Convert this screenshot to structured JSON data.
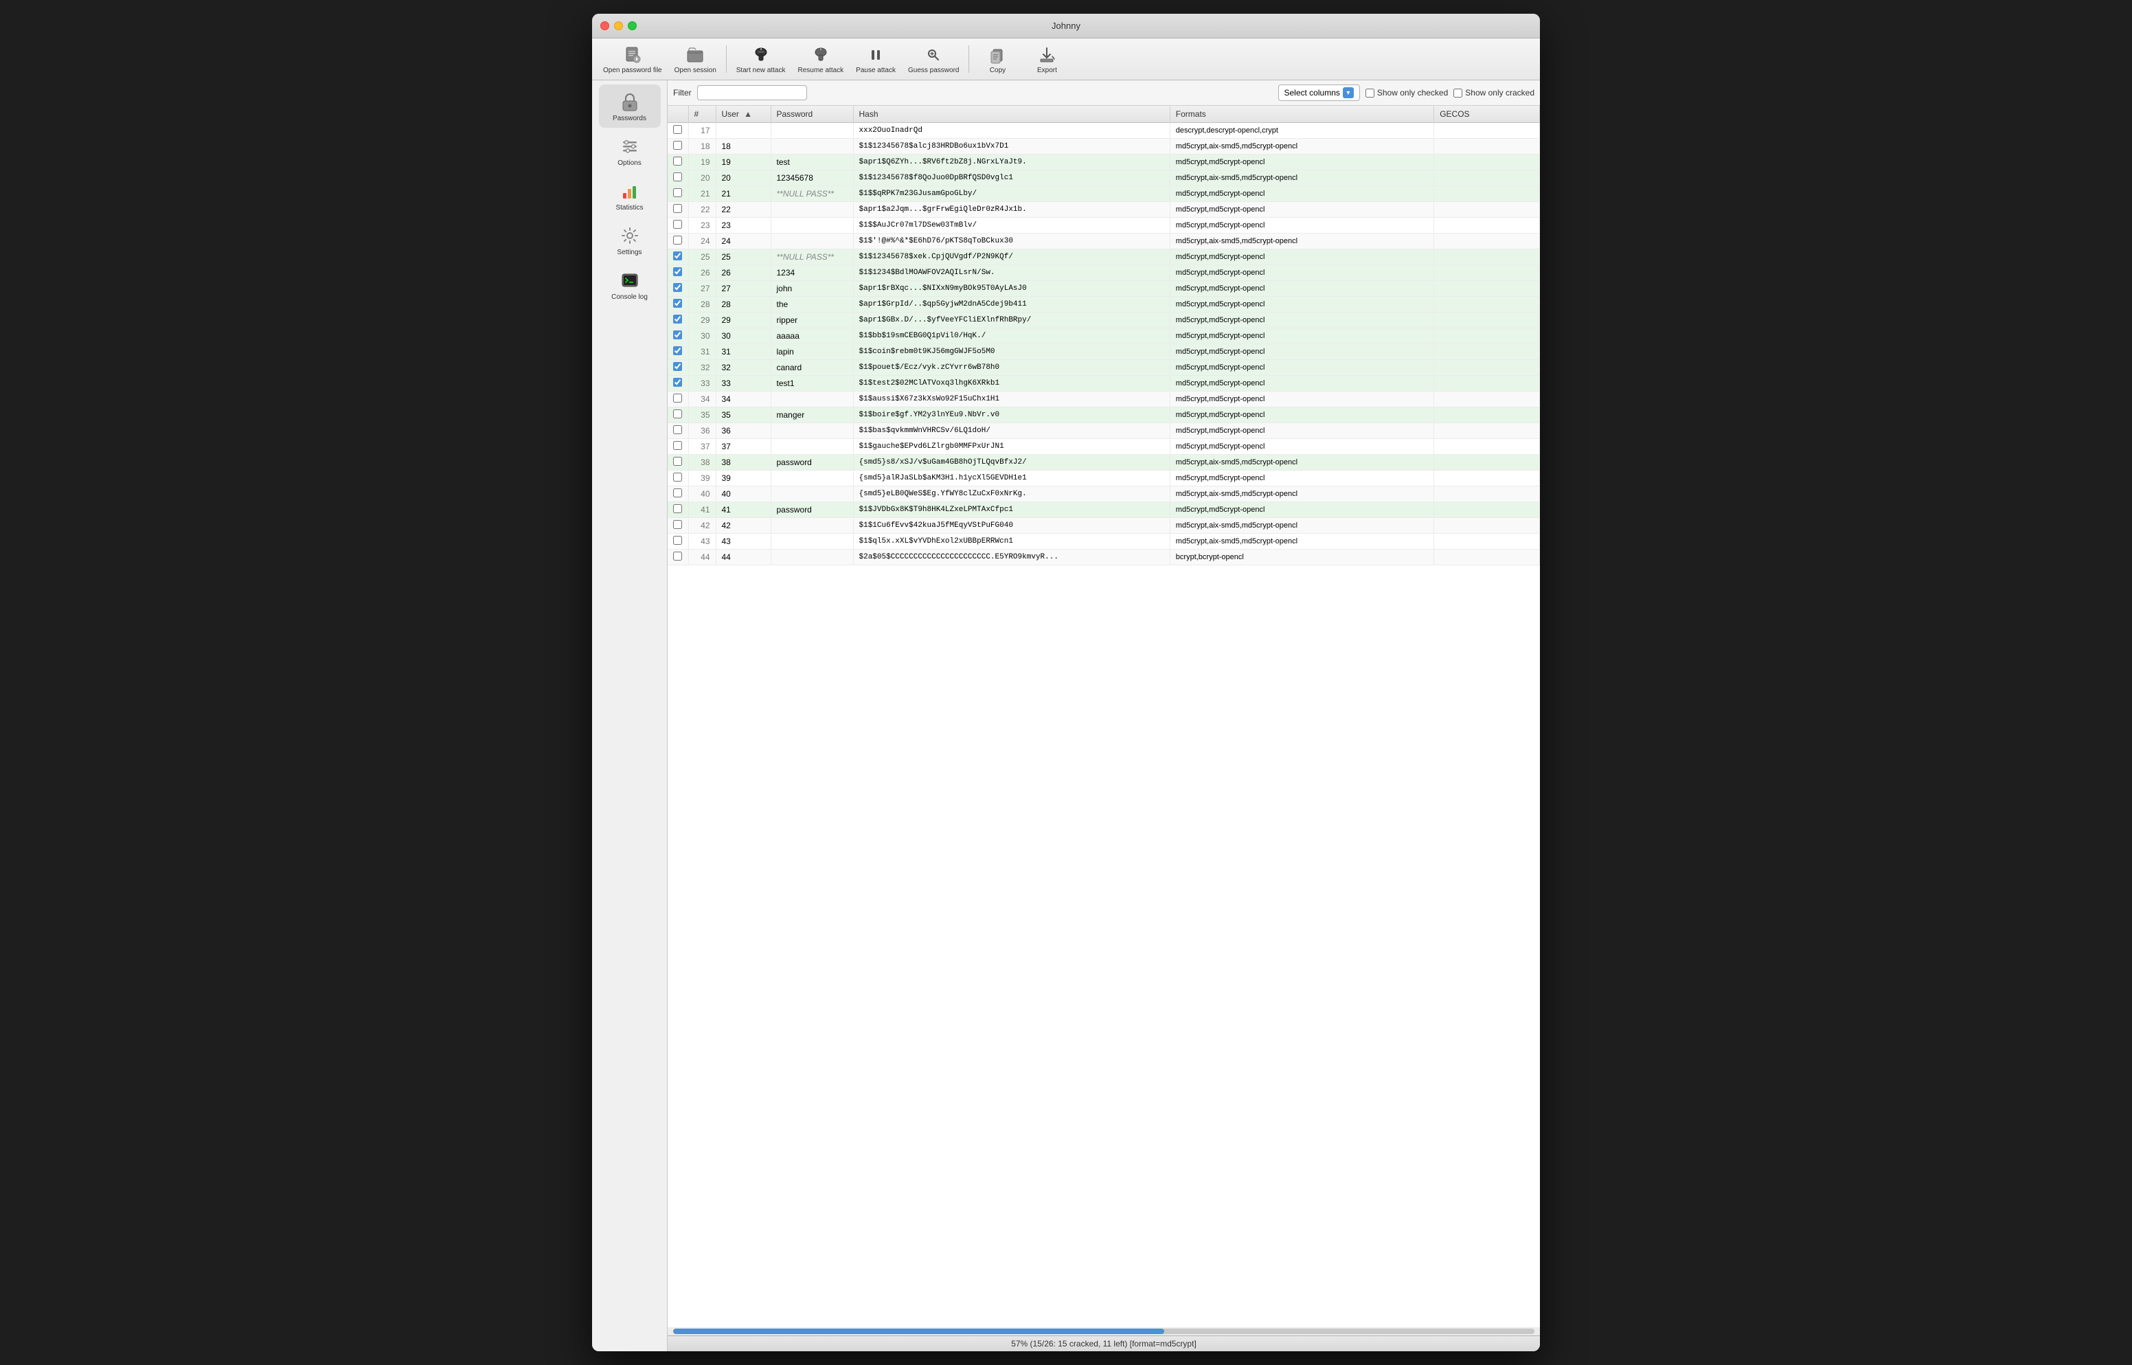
{
  "window": {
    "title": "Johnny"
  },
  "toolbar": {
    "buttons": [
      {
        "id": "open-password",
        "label": "Open password file",
        "icon": "📄"
      },
      {
        "id": "open-session",
        "label": "Open session",
        "icon": "📁"
      },
      {
        "id": "start-attack",
        "label": "Start new attack",
        "icon": "🎩"
      },
      {
        "id": "resume-attack",
        "label": "Resume attack",
        "icon": "▶"
      },
      {
        "id": "pause-attack",
        "label": "Pause attack",
        "icon": "⏸"
      },
      {
        "id": "guess-password",
        "label": "Guess password",
        "icon": "🔑"
      },
      {
        "id": "copy",
        "label": "Copy",
        "icon": "💾"
      },
      {
        "id": "export",
        "label": "Export",
        "icon": "📤"
      }
    ]
  },
  "sidebar": {
    "items": [
      {
        "id": "passwords",
        "label": "Passwords",
        "icon": "🔒",
        "active": true
      },
      {
        "id": "options",
        "label": "Options",
        "icon": "⚙️"
      },
      {
        "id": "statistics",
        "label": "Statistics",
        "icon": "📊"
      },
      {
        "id": "settings",
        "label": "Settings",
        "icon": "🔧"
      },
      {
        "id": "console-log",
        "label": "Console log",
        "icon": "💻"
      }
    ]
  },
  "filter": {
    "label": "Filter",
    "placeholder": "",
    "select_columns": "Select columns",
    "show_only_checked": "Show only checked",
    "show_only_cracked": "Show only cracked"
  },
  "table": {
    "columns": [
      "",
      "#",
      "User",
      "Password",
      "Hash",
      "Formats",
      "GECOS"
    ],
    "rows": [
      {
        "num": 17,
        "check": false,
        "user": "",
        "password": "",
        "hash": "xxx2OuoInadrQd",
        "formats": "descrypt,descrypt-opencl,crypt",
        "gecos": "",
        "cracked": false
      },
      {
        "num": 18,
        "check": false,
        "user": "18",
        "password": "",
        "hash": "$1$12345678$alcj83HRDBo6ux1bVx7D1",
        "formats": "md5crypt,aix-smd5,md5crypt-opencl",
        "gecos": "",
        "cracked": false
      },
      {
        "num": 19,
        "check": false,
        "user": "19",
        "password": "test",
        "hash": "$apr1$Q6ZYh...$RV6ft2bZ8j.NGrxLYaJt9.",
        "formats": "md5crypt,md5crypt-opencl",
        "gecos": "",
        "cracked": true
      },
      {
        "num": 20,
        "check": false,
        "user": "20",
        "password": "12345678",
        "hash": "$1$12345678$f8QoJuo0DpBRfQSD0vglc1",
        "formats": "md5crypt,aix-smd5,md5crypt-opencl",
        "gecos": "",
        "cracked": true
      },
      {
        "num": 21,
        "check": false,
        "user": "21",
        "password": "**NULL PASS**",
        "hash": "$1$$qRPK7m23GJusamGpoGLby/",
        "formats": "md5crypt,md5crypt-opencl",
        "gecos": "",
        "cracked": true
      },
      {
        "num": 22,
        "check": false,
        "user": "22",
        "password": "",
        "hash": "$apr1$a2Jqm...$grFrwEgiQleDr0zR4Jx1b.",
        "formats": "md5crypt,md5crypt-opencl",
        "gecos": "",
        "cracked": false
      },
      {
        "num": 23,
        "check": false,
        "user": "23",
        "password": "",
        "hash": "$1$$AuJCr07ml7DSew03TmBlv/",
        "formats": "md5crypt,md5crypt-opencl",
        "gecos": "",
        "cracked": false
      },
      {
        "num": 24,
        "check": false,
        "user": "24",
        "password": "",
        "hash": "$1$'!@#%^&*$E6hD76/pKTS8qToBCkux30",
        "formats": "md5crypt,aix-smd5,md5crypt-opencl",
        "gecos": "",
        "cracked": false
      },
      {
        "num": 25,
        "check": true,
        "user": "25",
        "password": "**NULL PASS**",
        "hash": "$1$12345678$xek.CpjQUVgdf/P2N9KQf/",
        "formats": "md5crypt,md5crypt-opencl",
        "gecos": "",
        "cracked": true
      },
      {
        "num": 26,
        "check": true,
        "user": "26",
        "password": "1234",
        "hash": "$1$1234$BdlMOAWFOV2AQILsrN/Sw.",
        "formats": "md5crypt,md5crypt-opencl",
        "gecos": "",
        "cracked": true
      },
      {
        "num": 27,
        "check": true,
        "user": "27",
        "password": "john",
        "hash": "$apr1$rBXqc...$NIXxN9myBOk95T0AyLAsJ0",
        "formats": "md5crypt,md5crypt-opencl",
        "gecos": "",
        "cracked": true
      },
      {
        "num": 28,
        "check": true,
        "user": "28",
        "password": "the",
        "hash": "$apr1$GrpId/..$qp5GyjwM2dnA5Cdej9b411",
        "formats": "md5crypt,md5crypt-opencl",
        "gecos": "",
        "cracked": true
      },
      {
        "num": 29,
        "check": true,
        "user": "29",
        "password": "ripper",
        "hash": "$apr1$GBx.D/...$yfVeeYFCliEXlnfRhBRpy/",
        "formats": "md5crypt,md5crypt-opencl",
        "gecos": "",
        "cracked": true
      },
      {
        "num": 30,
        "check": true,
        "user": "30",
        "password": "aaaaa",
        "hash": "$1$bb$19smCEBG0Q1pVil0/HqK./",
        "formats": "md5crypt,md5crypt-opencl",
        "gecos": "",
        "cracked": true
      },
      {
        "num": 31,
        "check": true,
        "user": "31",
        "password": "lapin",
        "hash": "$1$coin$rebm0t9KJ56mgGWJF5o5M0",
        "formats": "md5crypt,md5crypt-opencl",
        "gecos": "",
        "cracked": true
      },
      {
        "num": 32,
        "check": true,
        "user": "32",
        "password": "canard",
        "hash": "$1$pouet$/Ecz/vyk.zCYvrr6wB78h0",
        "formats": "md5crypt,md5crypt-opencl",
        "gecos": "",
        "cracked": true
      },
      {
        "num": 33,
        "check": true,
        "user": "33",
        "password": "test1",
        "hash": "$1$test2$02MClATVoxq3lhgK6XRkb1",
        "formats": "md5crypt,md5crypt-opencl",
        "gecos": "",
        "cracked": true
      },
      {
        "num": 34,
        "check": false,
        "user": "34",
        "password": "",
        "hash": "$1$aussi$X67z3kXsWo92F15uChx1H1",
        "formats": "md5crypt,md5crypt-opencl",
        "gecos": "",
        "cracked": false
      },
      {
        "num": 35,
        "check": false,
        "user": "35",
        "password": "manger",
        "hash": "$1$boire$gf.YM2y3lnYEu9.NbVr.v0",
        "formats": "md5crypt,md5crypt-opencl",
        "gecos": "",
        "cracked": true
      },
      {
        "num": 36,
        "check": false,
        "user": "36",
        "password": "",
        "hash": "$1$bas$qvkmmWnVHRCSv/6LQ1doH/",
        "formats": "md5crypt,md5crypt-opencl",
        "gecos": "",
        "cracked": false
      },
      {
        "num": 37,
        "check": false,
        "user": "37",
        "password": "",
        "hash": "$1$gauche$EPvd6LZlrgb0MMFPxUrJN1",
        "formats": "md5crypt,md5crypt-opencl",
        "gecos": "",
        "cracked": false
      },
      {
        "num": 38,
        "check": false,
        "user": "38",
        "password": "password",
        "hash": "{smd5}s8/xSJ/v$uGam4GB8hOjTLQqvBfxJ2/",
        "formats": "md5crypt,aix-smd5,md5crypt-opencl",
        "gecos": "",
        "cracked": true
      },
      {
        "num": 39,
        "check": false,
        "user": "39",
        "password": "",
        "hash": "{smd5}alRJaSLb$aKM3H1.h1ycXl5GEVDH1e1",
        "formats": "md5crypt,md5crypt-opencl",
        "gecos": "",
        "cracked": false
      },
      {
        "num": 40,
        "check": false,
        "user": "40",
        "password": "",
        "hash": "{smd5}eLB0QWeS$Eg.YfWY8clZuCxF0xNrKg.",
        "formats": "md5crypt,aix-smd5,md5crypt-opencl",
        "gecos": "",
        "cracked": false
      },
      {
        "num": 41,
        "check": false,
        "user": "41",
        "password": "password",
        "hash": "$1$JVDbGx8K$T9h8HK4LZxeLPMTAxCfpc1",
        "formats": "md5crypt,md5crypt-opencl",
        "gecos": "",
        "cracked": true
      },
      {
        "num": 42,
        "check": false,
        "user": "42",
        "password": "",
        "hash": "$1$1Cu6fEvv$42kuaJ5fMEqyVStPuFG040",
        "formats": "md5crypt,aix-smd5,md5crypt-opencl",
        "gecos": "",
        "cracked": false
      },
      {
        "num": 43,
        "check": false,
        "user": "43",
        "password": "",
        "hash": "$1$ql5x.xXL$vYVDhExol2xUBBpERRWcn1",
        "formats": "md5crypt,aix-smd5,md5crypt-opencl",
        "gecos": "",
        "cracked": false
      },
      {
        "num": 44,
        "check": false,
        "user": "44",
        "password": "",
        "hash": "$2a$05$CCCCCCCCCCCCCCCCCCCCCC.E5YRO9kmvyR...",
        "formats": "bcrypt,bcrypt-opencl",
        "gecos": "",
        "cracked": false
      }
    ]
  },
  "status": {
    "text": "57% (15/26: 15 cracked, 11 left) [format=md5crypt]",
    "progress": 57
  }
}
